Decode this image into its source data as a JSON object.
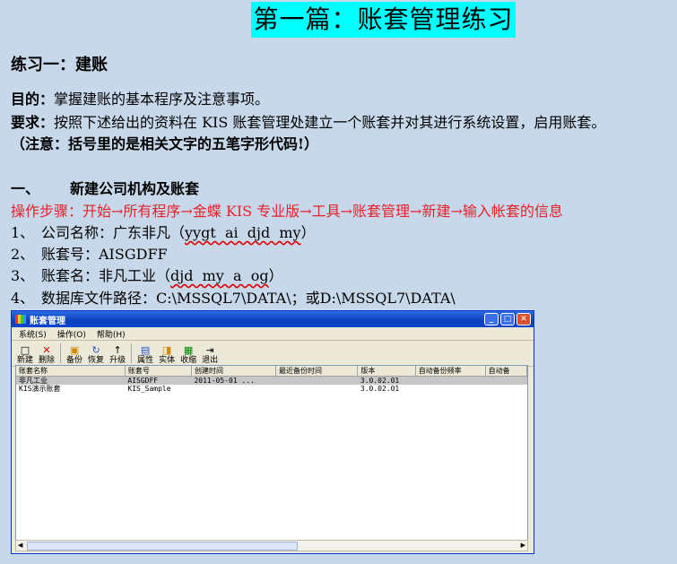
{
  "title": "第一篇：账套管理练习",
  "exercise": "练习一：建账",
  "goal_label": "目的：",
  "goal_text": "掌握建账的基本程序及注意事项。",
  "req_label": "要求：",
  "req_text": "按照下述给出的资料在 KIS 账套管理处建立一个账套并对其进行系统设置，启用账套。",
  "note": "（注意：括号里的是相关文字的五笔字形代码!）",
  "section_num": "一、",
  "section_title": "新建公司机构及账套",
  "steps": "操作步骤：开始→所有程序→金蝶 KIS 专业版→工具→账套管理→新建→输入帐套的信息",
  "items": [
    {
      "num": "1、",
      "label": "公司名称：广东非凡（",
      "code": "yygt  ai  djd  my",
      "end": "）"
    },
    {
      "num": "2、",
      "label": "账套号：AISGDFF"
    },
    {
      "num": "3、",
      "label": "账套名：非凡工业（",
      "code": "djd  my  a  og",
      "end": "）"
    },
    {
      "num": "4、",
      "label": "数据库文件路径：C:\\MSSQL7\\DATA\\；或D:\\MSSQL7\\DATA\\"
    }
  ],
  "window": {
    "title": "账套管理",
    "menu": [
      "系统(S)",
      "操作(O)",
      "帮助(H)"
    ],
    "tools": [
      {
        "icon": "□",
        "label": "新建"
      },
      {
        "icon": "✕",
        "label": "删除"
      },
      {
        "icon": "▣",
        "label": "备份"
      },
      {
        "icon": "↻",
        "label": "恢复"
      },
      {
        "icon": "↑",
        "label": "升级"
      },
      {
        "icon": "▤",
        "label": "属性"
      },
      {
        "icon": "◨",
        "label": "实体"
      },
      {
        "icon": "▦",
        "label": "收缩"
      },
      {
        "icon": "⇥",
        "label": "退出"
      }
    ],
    "columns": [
      "账套名称",
      "账套号",
      "创建时间",
      "最近备份时间",
      "版本",
      "自动备份频率",
      "自动备"
    ],
    "rows": [
      [
        "非凡工业",
        "AISGDFF",
        "2011-05-01 ...",
        "",
        "3.0.02.01",
        "",
        ""
      ],
      [
        "KIS演示账套",
        "KIS_Sample",
        "",
        "",
        "3.0.02.01",
        "",
        ""
      ]
    ]
  },
  "colors": {
    "title_bg": "#00ffff",
    "page_bg": "#c7d8ea",
    "steps_text": "#e8202a"
  }
}
